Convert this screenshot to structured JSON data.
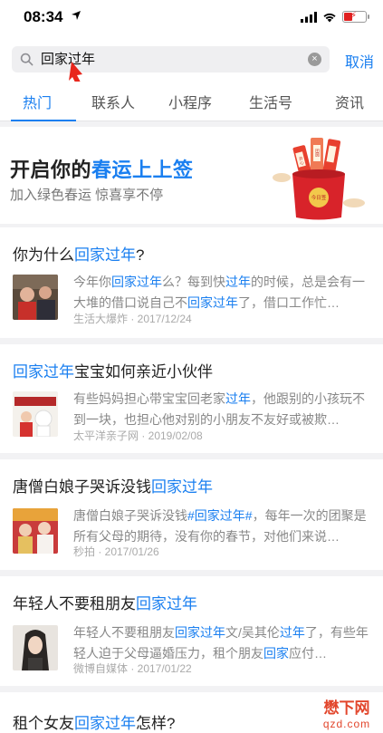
{
  "status": {
    "time": "08:34"
  },
  "search": {
    "query": "回家过年",
    "cancel_label": "取消",
    "clear_symbol": "×"
  },
  "tabs": [
    {
      "label": "热门",
      "active": true
    },
    {
      "label": "联系人"
    },
    {
      "label": "小程序"
    },
    {
      "label": "生活号"
    },
    {
      "label": "资讯"
    }
  ],
  "banner": {
    "title_prefix": "开启你的",
    "title_highlight": "春运上上签",
    "subtitle": "加入绿色春运 惊喜享不停",
    "art_labels": [
      "开心",
      "团圆",
      "今日签"
    ]
  },
  "articles": [
    {
      "title": [
        {
          "t": "你为什么"
        },
        {
          "t": "回家过年",
          "hl": true
        },
        {
          "t": "?"
        }
      ],
      "excerpt": [
        {
          "t": "今年你"
        },
        {
          "t": "回家过年",
          "hl": true
        },
        {
          "t": "么？每到快"
        },
        {
          "t": "过年",
          "hl": true
        },
        {
          "t": "的时候，总是会有一大堆的借口说自己不"
        },
        {
          "t": "回家过年",
          "hl": true
        },
        {
          "t": "了，借口工作忙…"
        }
      ],
      "source": "生活大爆炸 · 2017/12/24"
    },
    {
      "title": [
        {
          "t": "回家过年",
          "hl": true
        },
        {
          "t": "宝宝如何亲近小伙伴"
        }
      ],
      "excerpt": [
        {
          "t": "有些妈妈担心带宝宝回老家"
        },
        {
          "t": "过年",
          "hl": true
        },
        {
          "t": "，他跟别的小孩玩不到一块，也担心他对别的小朋友不友好或被欺…"
        }
      ],
      "source": "太平洋亲子网 · 2019/02/08"
    },
    {
      "title": [
        {
          "t": "唐僧白娘子哭诉没钱"
        },
        {
          "t": "回家过年",
          "hl": true
        }
      ],
      "excerpt": [
        {
          "t": "唐僧白娘子哭诉没钱"
        },
        {
          "t": "#回家过年#",
          "hl": true
        },
        {
          "t": "，每年一次的团聚是所有父母的期待，没有你的春节，对他们来说…"
        }
      ],
      "source": "秒拍 · 2017/01/26"
    },
    {
      "title": [
        {
          "t": "年轻人不要租朋友"
        },
        {
          "t": "回家过年",
          "hl": true
        }
      ],
      "excerpt": [
        {
          "t": "年轻人不要租朋友"
        },
        {
          "t": "回家过年",
          "hl": true
        },
        {
          "t": "文/吴其伦"
        },
        {
          "t": "过年",
          "hl": true
        },
        {
          "t": "了，有些年轻人迫于父母逼婚压力，租个朋友"
        },
        {
          "t": "回家",
          "hl": true
        },
        {
          "t": "应付…"
        }
      ],
      "source": "微博自媒体 · 2017/01/22"
    },
    {
      "title": [
        {
          "t": "租个女友"
        },
        {
          "t": "回家过年",
          "hl": true
        },
        {
          "t": "怎样?"
        }
      ]
    }
  ],
  "watermark": {
    "top": "懋下网",
    "bottom": "qzd.com"
  },
  "colors": {
    "accent": "#1a7ff0",
    "background": "#f2f2f4"
  }
}
